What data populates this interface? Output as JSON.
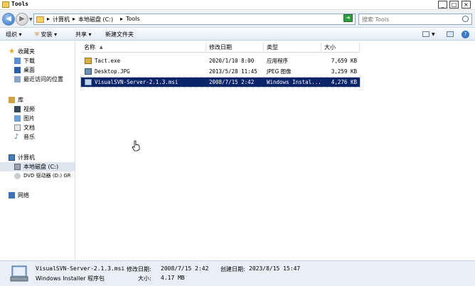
{
  "window": {
    "title": "Tools"
  },
  "address": {
    "crumbs": [
      "计算机",
      "本地磁盘 (C:)",
      "Tools"
    ],
    "search_placeholder": "搜索 Tools"
  },
  "toolbar": {
    "organize": "组织",
    "install": "安装",
    "share": "共享",
    "new_folder": "新建文件夹"
  },
  "nav": {
    "favorites": "收藏夹",
    "fav_items": [
      "下载",
      "桌面",
      "最近访问的位置"
    ],
    "libraries": "库",
    "lib_items": [
      "视频",
      "图片",
      "文档",
      "音乐"
    ],
    "computer": "计算机",
    "comp_items": [
      "本地磁盘 (C:)",
      "DVD 驱动器 (D:) GR"
    ],
    "network": "网络"
  },
  "columns": {
    "name": "名称",
    "date": "修改日期",
    "type": "类型",
    "size": "大小"
  },
  "files": [
    {
      "name": "Tact.exe",
      "date": "2020/1/10 8:00",
      "type": "应用程序",
      "size": "7,659 KB"
    },
    {
      "name": "Desktop.JPG",
      "date": "2013/5/28 11:45",
      "type": "JPEG 图像",
      "size": "3,259 KB"
    },
    {
      "name": "VisualSVN-Server-2.1.3.msi",
      "date": "2008/7/15 2:42",
      "type": "Windows Instal...",
      "size": "4,276 KB"
    }
  ],
  "details": {
    "filename": "VisualSVN-Server-2.1.3.msi",
    "filetype": "Windows Installer 程序包",
    "modified_label": "修改日期:",
    "modified": "2008/7/15 2:42",
    "created_label": "创建日期:",
    "created": "2023/8/15 15:47",
    "size_label": "大小:",
    "size": "4.17 MB"
  },
  "colors": {
    "selection": "#0a246a",
    "accent": "#2c6fbf"
  }
}
